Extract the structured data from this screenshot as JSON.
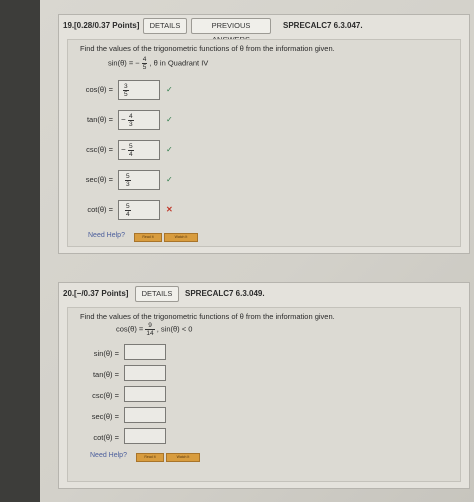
{
  "q19": {
    "number": "19.",
    "points": "[0.28/0.37 Points]",
    "details": "DETAILS",
    "previous": "PREVIOUS ANSWERS",
    "code": "SPRECALC7 6.3.047.",
    "prompt": "Find the values of the trigonometric functions of θ from the information given.",
    "given_lhs": "sin(θ) = −",
    "given_num": "4",
    "given_den": "5",
    "given_rhs": ", θ in Quadrant IV",
    "answers": [
      {
        "label": "cos(θ) =",
        "sign": "",
        "num": "3",
        "den": "5",
        "status": "✓"
      },
      {
        "label": "tan(θ) =",
        "sign": "−",
        "num": "4",
        "den": "3",
        "status": "✓"
      },
      {
        "label": "csc(θ) =",
        "sign": "−",
        "num": "5",
        "den": "4",
        "status": "✓"
      },
      {
        "label": "sec(θ) =",
        "sign": "",
        "num": "5",
        "den": "3",
        "status": "✓"
      },
      {
        "label": "cot(θ) =",
        "sign": "",
        "num": "5",
        "den": "4",
        "status": "✕"
      }
    ],
    "need_help": "Need Help?",
    "read_it": "Read It",
    "watch_it": "Watch It"
  },
  "q20": {
    "number": "20.",
    "points": "[−/0.37 Points]",
    "details": "DETAILS",
    "code": "SPRECALC7 6.3.049.",
    "prompt": "Find the values of the trigonometric functions of θ from the information given.",
    "given_lhs": "cos(θ) =",
    "given_num": "9",
    "given_den": "14",
    "given_rhs": ",  sin(θ) < 0",
    "labels": [
      "sin(θ) =",
      "tan(θ) =",
      "csc(θ) =",
      "sec(θ) =",
      "cot(θ) ="
    ],
    "need_help": "Need Help?",
    "read_it": "Read It",
    "watch_it": "Watch It"
  },
  "colors": {
    "check": "#2e7d4a",
    "cross": "#c0392b",
    "help_button": "#d89c3e"
  }
}
